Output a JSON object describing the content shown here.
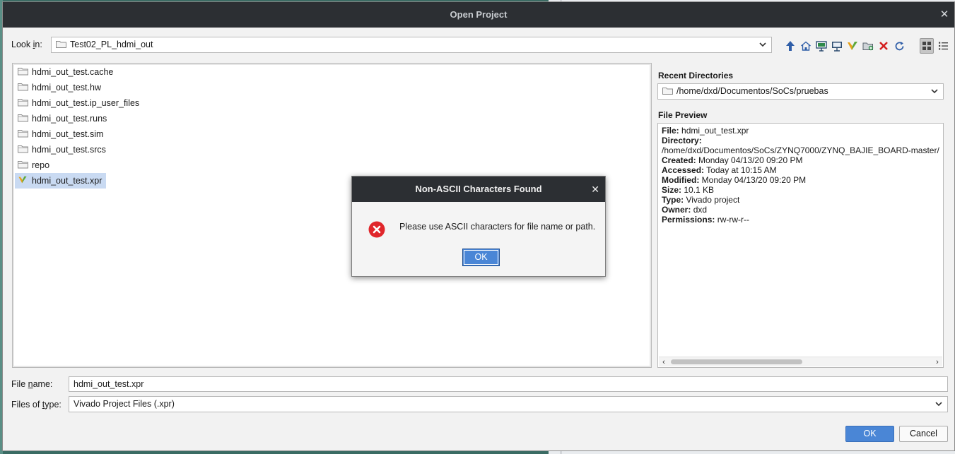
{
  "window": {
    "title": "Open Project",
    "close_glyph": "✕"
  },
  "look_in": {
    "label_prefix": "Look ",
    "label_underline": "i",
    "label_suffix": "n:",
    "value": "Test02_PL_hdmi_out"
  },
  "toolbar": {
    "icons": [
      "up-folder-icon",
      "home-icon",
      "desktop-icon",
      "computer-icon",
      "vivado-icon",
      "new-folder-icon",
      "delete-icon",
      "refresh-icon",
      "grid-view-icon",
      "list-view-icon"
    ]
  },
  "files": [
    {
      "name": "hdmi_out_test.cache",
      "type": "folder"
    },
    {
      "name": "hdmi_out_test.hw",
      "type": "folder"
    },
    {
      "name": "hdmi_out_test.ip_user_files",
      "type": "folder"
    },
    {
      "name": "hdmi_out_test.runs",
      "type": "folder"
    },
    {
      "name": "hdmi_out_test.sim",
      "type": "folder"
    },
    {
      "name": "hdmi_out_test.srcs",
      "type": "folder"
    },
    {
      "name": "repo",
      "type": "folder"
    },
    {
      "name": "hdmi_out_test.xpr",
      "type": "vivado-project",
      "selected": true
    }
  ],
  "recent": {
    "title": "Recent Directories",
    "value": "/home/dxd/Documentos/SoCs/pruebas"
  },
  "preview": {
    "title": "File Preview",
    "file_label": "File:",
    "file_value": "hdmi_out_test.xpr",
    "directory_label": "Directory:",
    "directory_value": "/home/dxd/Documentos/SoCs/ZYNQ7000/ZYNQ_BAJIE_BOARD-master/",
    "created_label": "Created:",
    "created_value": "Monday 04/13/20 09:20 PM",
    "accessed_label": "Accessed:",
    "accessed_value": "Today at 10:15 AM",
    "modified_label": "Modified:",
    "modified_value": "Monday 04/13/20 09:20 PM",
    "size_label": "Size:",
    "size_value": "10.1 KB",
    "type_label": "Type:",
    "type_value": "Vivado project",
    "owner_label": "Owner:",
    "owner_value": "dxd",
    "permissions_label": "Permissions:",
    "permissions_value": "rw-rw-r--"
  },
  "file_name": {
    "label_prefix": "File ",
    "label_underline": "n",
    "label_suffix": "ame:",
    "value": "hdmi_out_test.xpr"
  },
  "files_of_type": {
    "label_prefix": "Files of ",
    "label_underline": "t",
    "label_suffix": "ype:",
    "value": "Vivado Project Files (.xpr)"
  },
  "buttons": {
    "ok": "OK",
    "cancel": "Cancel"
  },
  "dialog": {
    "title": "Non-ASCII Characters Found",
    "close_glyph": "✕",
    "message": "Please use ASCII characters for file name or path.",
    "ok": "OK",
    "icon": "error-icon"
  },
  "colors": {
    "accent": "#4a86d6",
    "titlebar": "#2c2f33",
    "selection": "#c9daf2",
    "error": "#e0262b"
  }
}
